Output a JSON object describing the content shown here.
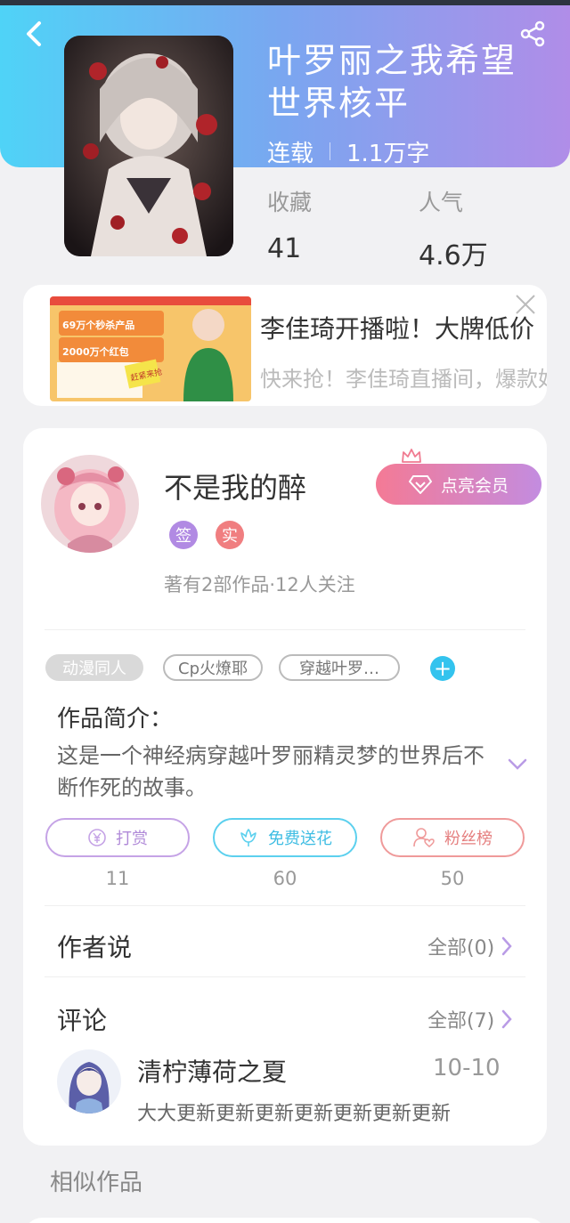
{
  "header": {
    "title": "叶罗丽之我希望世界核平",
    "status": "连载",
    "word_count": "1.1万字",
    "stats": [
      {
        "label": "收藏",
        "value": "41"
      },
      {
        "label": "人气",
        "value": "4.6万"
      }
    ],
    "gradient": [
      "#4fd3f7",
      "#b08de8"
    ]
  },
  "ad": {
    "title": "李佳琦开播啦！大牌低价",
    "desc": "快来抢！李佳琦直播间，爆款好物",
    "banner_line1": "69万个秒杀产品",
    "banner_line2": "2000万个红包",
    "banner_stamp": "赶紧来抢"
  },
  "author": {
    "name": "不是我的醉",
    "vip_label": "点亮会员",
    "badges": [
      "签",
      "实"
    ],
    "meta": "著有2部作品·12人关注"
  },
  "tags": [
    "动漫同人",
    "Cp火燎耶",
    "穿越叶罗…"
  ],
  "intro": {
    "title": "作品简介：",
    "text": "这是一个神经病穿越叶罗丽精灵梦的世界后不断作死的故事。"
  },
  "actions": [
    {
      "label": "打赏",
      "count": "11",
      "color": "#c5a3e6"
    },
    {
      "label": "免费送花",
      "count": "60",
      "color": "#5cd0ee"
    },
    {
      "label": "粉丝榜",
      "count": "50",
      "color": "#ef9a9a"
    }
  ],
  "author_say": {
    "title": "作者说",
    "more": "全部(0)"
  },
  "comments": {
    "title": "评论",
    "more": "全部(7)",
    "items": [
      {
        "user": "清柠薄荷之夏",
        "date": "10-10",
        "text": "大大更新更新更新更新更新更新更新"
      }
    ]
  },
  "similar": {
    "title": "相似作品"
  },
  "icons": [
    "back-icon",
    "share-icon",
    "close-icon",
    "diamond-icon",
    "crown-icon",
    "plus-icon",
    "chevron-down-icon",
    "yen-icon",
    "flower-icon",
    "fans-icon",
    "chevron-right-icon"
  ]
}
